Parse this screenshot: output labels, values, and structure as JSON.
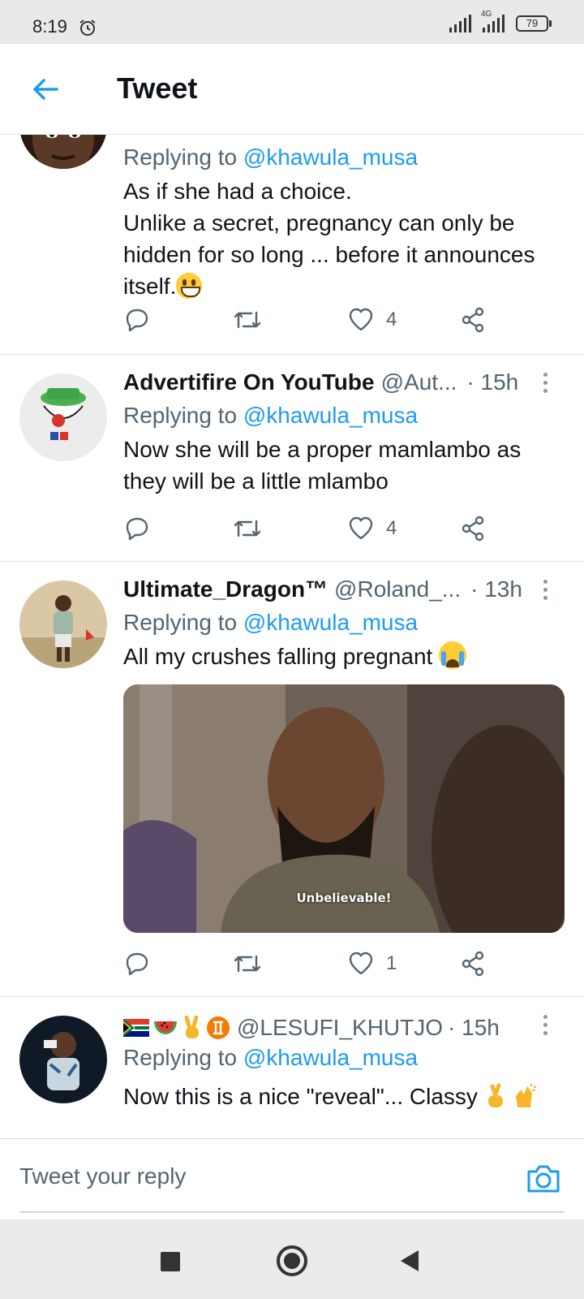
{
  "status_bar": {
    "time": "8:19",
    "network": "4G",
    "battery": "79"
  },
  "header": {
    "title": "Tweet"
  },
  "tweets": [
    {
      "reply_prefix": "Replying to",
      "mention": "@khawula_musa",
      "text_lines": [
        "As if she had a choice.",
        "Unlike a secret, pregnancy can only be",
        "hidden for so long ... before it announces",
        "itself."
      ],
      "likes": "4"
    },
    {
      "name": "Advertifire On YouTube",
      "handle": "@Aut...",
      "time": "· 15h",
      "reply_prefix": "Replying to",
      "mention": "@khawula_musa",
      "text_lines": [
        "Now she will be a proper mamlambo as",
        "they will be a little mlambo"
      ],
      "likes": "4"
    },
    {
      "name": "Ultimate_Dragon™",
      "handle": "@Roland_...",
      "time": "· 13h",
      "reply_prefix": "Replying to",
      "mention": "@khawula_musa",
      "text": "All my crushes falling pregnant",
      "media_caption": "Unbelievable!",
      "likes": "1"
    },
    {
      "handle": "@LESUFI_KHUTJO",
      "time": "· 15h",
      "reply_prefix": "Replying to",
      "mention": "@khawula_musa",
      "text": "Now this is a nice \"reveal\"... Classy"
    }
  ],
  "composer": {
    "placeholder": "Tweet your reply"
  },
  "colors": {
    "accent": "#1d9bf0",
    "secondary_text": "#536471",
    "divider": "#e1e4e6"
  }
}
